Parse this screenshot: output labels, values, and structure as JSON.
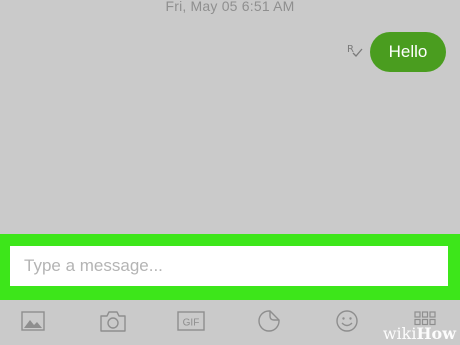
{
  "conversation": {
    "timestamp": "Fri, May 05 6:51 AM",
    "messages": [
      {
        "text": "Hello",
        "direction": "outgoing",
        "status_icon": "read-receipt-icon"
      }
    ]
  },
  "composer": {
    "placeholder": "Type a message...",
    "value": "",
    "highlight_color": "#3de61a"
  },
  "toolbar": {
    "items": [
      {
        "icon": "gallery-icon"
      },
      {
        "icon": "camera-icon"
      },
      {
        "icon": "gif-icon",
        "label": "GIF"
      },
      {
        "icon": "sticker-icon"
      },
      {
        "icon": "emoji-icon"
      },
      {
        "icon": "more-apps-icon"
      }
    ]
  },
  "watermark": {
    "text_left": "wiki",
    "text_right": "How"
  },
  "colors": {
    "background": "#cacaca",
    "bubble": "#4a9d1f",
    "icon": "#8e8e8e"
  }
}
